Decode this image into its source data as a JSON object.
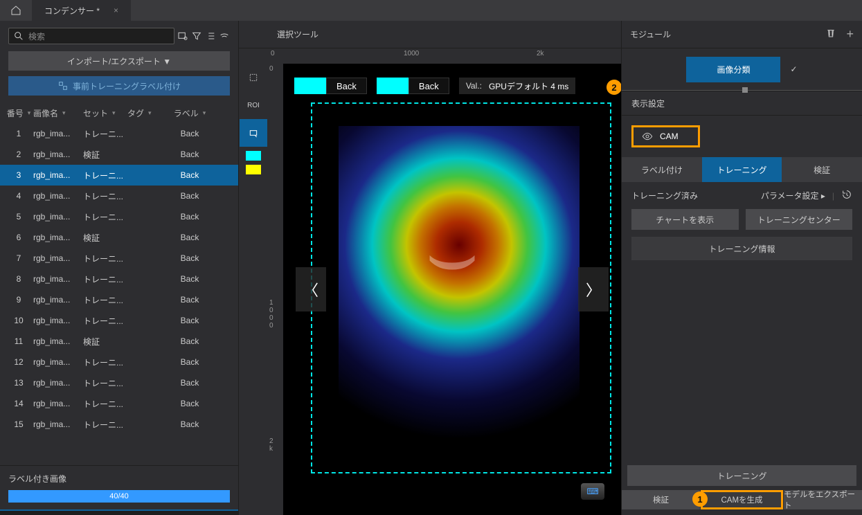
{
  "tab_title": "コンデンサー *",
  "search_placeholder": "検索",
  "import_export": "インポート/エクスポート ▼",
  "pretrain_label": "事前トレーニングラベル付け",
  "table": {
    "headers": {
      "num": "番号",
      "name": "画像名",
      "set": "セット",
      "tag": "タグ",
      "label": "ラベル"
    },
    "rows": [
      {
        "n": "1",
        "name": "rgb_ima...",
        "set": "トレーニ...",
        "tag": "",
        "label": "Back"
      },
      {
        "n": "2",
        "name": "rgb_ima...",
        "set": "検証",
        "tag": "",
        "label": "Back"
      },
      {
        "n": "3",
        "name": "rgb_ima...",
        "set": "トレーニ...",
        "tag": "",
        "label": "Back",
        "selected": true
      },
      {
        "n": "4",
        "name": "rgb_ima...",
        "set": "トレーニ...",
        "tag": "",
        "label": "Back"
      },
      {
        "n": "5",
        "name": "rgb_ima...",
        "set": "トレーニ...",
        "tag": "",
        "label": "Back"
      },
      {
        "n": "6",
        "name": "rgb_ima...",
        "set": "検証",
        "tag": "",
        "label": "Back"
      },
      {
        "n": "7",
        "name": "rgb_ima...",
        "set": "トレーニ...",
        "tag": "",
        "label": "Back"
      },
      {
        "n": "8",
        "name": "rgb_ima...",
        "set": "トレーニ...",
        "tag": "",
        "label": "Back"
      },
      {
        "n": "9",
        "name": "rgb_ima...",
        "set": "トレーニ...",
        "tag": "",
        "label": "Back"
      },
      {
        "n": "10",
        "name": "rgb_ima...",
        "set": "トレーニ...",
        "tag": "",
        "label": "Back"
      },
      {
        "n": "11",
        "name": "rgb_ima...",
        "set": "検証",
        "tag": "",
        "label": "Back"
      },
      {
        "n": "12",
        "name": "rgb_ima...",
        "set": "トレーニ...",
        "tag": "",
        "label": "Back"
      },
      {
        "n": "13",
        "name": "rgb_ima...",
        "set": "トレーニ...",
        "tag": "",
        "label": "Back"
      },
      {
        "n": "14",
        "name": "rgb_ima...",
        "set": "トレーニ...",
        "tag": "",
        "label": "Back"
      },
      {
        "n": "15",
        "name": "rgb_ima...",
        "set": "トレーニ...",
        "tag": "",
        "label": "Back"
      }
    ]
  },
  "labeled_images": "ラベル付き画像",
  "progress_text": "40/40",
  "center_title": "選択ツール",
  "roi_label": "ROI",
  "ruler_h": {
    "t0": "0",
    "t1": "1000",
    "t2": "2k"
  },
  "ruler_v": {
    "t0": "0",
    "t1": "1\n0\n0\n0",
    "t2": "2\nk"
  },
  "anno1": "Back",
  "anno2": "Back",
  "val_prefix": "Val.:",
  "val_text": "GPUデフォルト 4 ms",
  "right_title": "モジュール",
  "module_name": "画像分類",
  "display_settings": "表示設定",
  "cam_label": "CAM",
  "tabs": {
    "a": "ラベル付け",
    "b": "トレーニング",
    "c": "検証"
  },
  "trained": "トレーニング済み",
  "param": "パラメータ設定 ▸",
  "show_chart": "チャートを表示",
  "training_center": "トレーニングセンター",
  "training_info": "トレーニング情報",
  "train_btn": "トレーニング",
  "verify_btn": "検証",
  "gen_cam": "CAMを生成",
  "export_model": "モデルをエクスポート",
  "badge1": "1",
  "badge2": "2",
  "swatch_colors": {
    "cyan": "#00ffff",
    "yellow": "#ffff00"
  }
}
